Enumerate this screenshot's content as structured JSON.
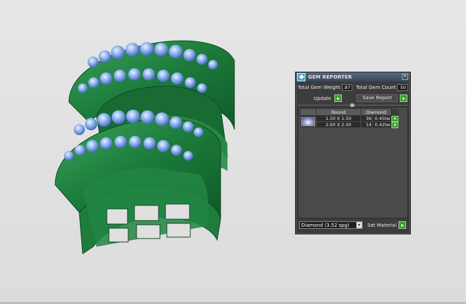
{
  "window": {
    "title": "GEM REPORTER",
    "close_glyph": "✕"
  },
  "totals": {
    "weight_label": "Total Gem Weight",
    "weight_value": ".87",
    "count_label": "Total Gem Count",
    "count_value": "50"
  },
  "actions": {
    "update_label": "Update",
    "save_label": "Save Report"
  },
  "table": {
    "headers": [
      "",
      "Round",
      "Diamond",
      ""
    ],
    "rows": [
      {
        "size": "1.50 X 1.50",
        "count": "36",
        "weight": "0.45tw"
      },
      {
        "size": "2.00 X 2.00",
        "count": "14",
        "weight": "0.42tw"
      }
    ]
  },
  "material": {
    "selected": "Diamond    (3.52 spg)",
    "caret": "▾",
    "set_label": "Set Material"
  },
  "icons": [
    "gem-reporter-app-icon",
    "close-icon",
    "update-go-icon",
    "save-go-icon",
    "gem-preview-icon",
    "row-go-icon",
    "set-material-go-icon"
  ],
  "colors": {
    "metal": "#1f7a3c",
    "gem": "#8fb4f0",
    "panel": "#3c3c3c",
    "go_button": "#3d9b2e"
  }
}
